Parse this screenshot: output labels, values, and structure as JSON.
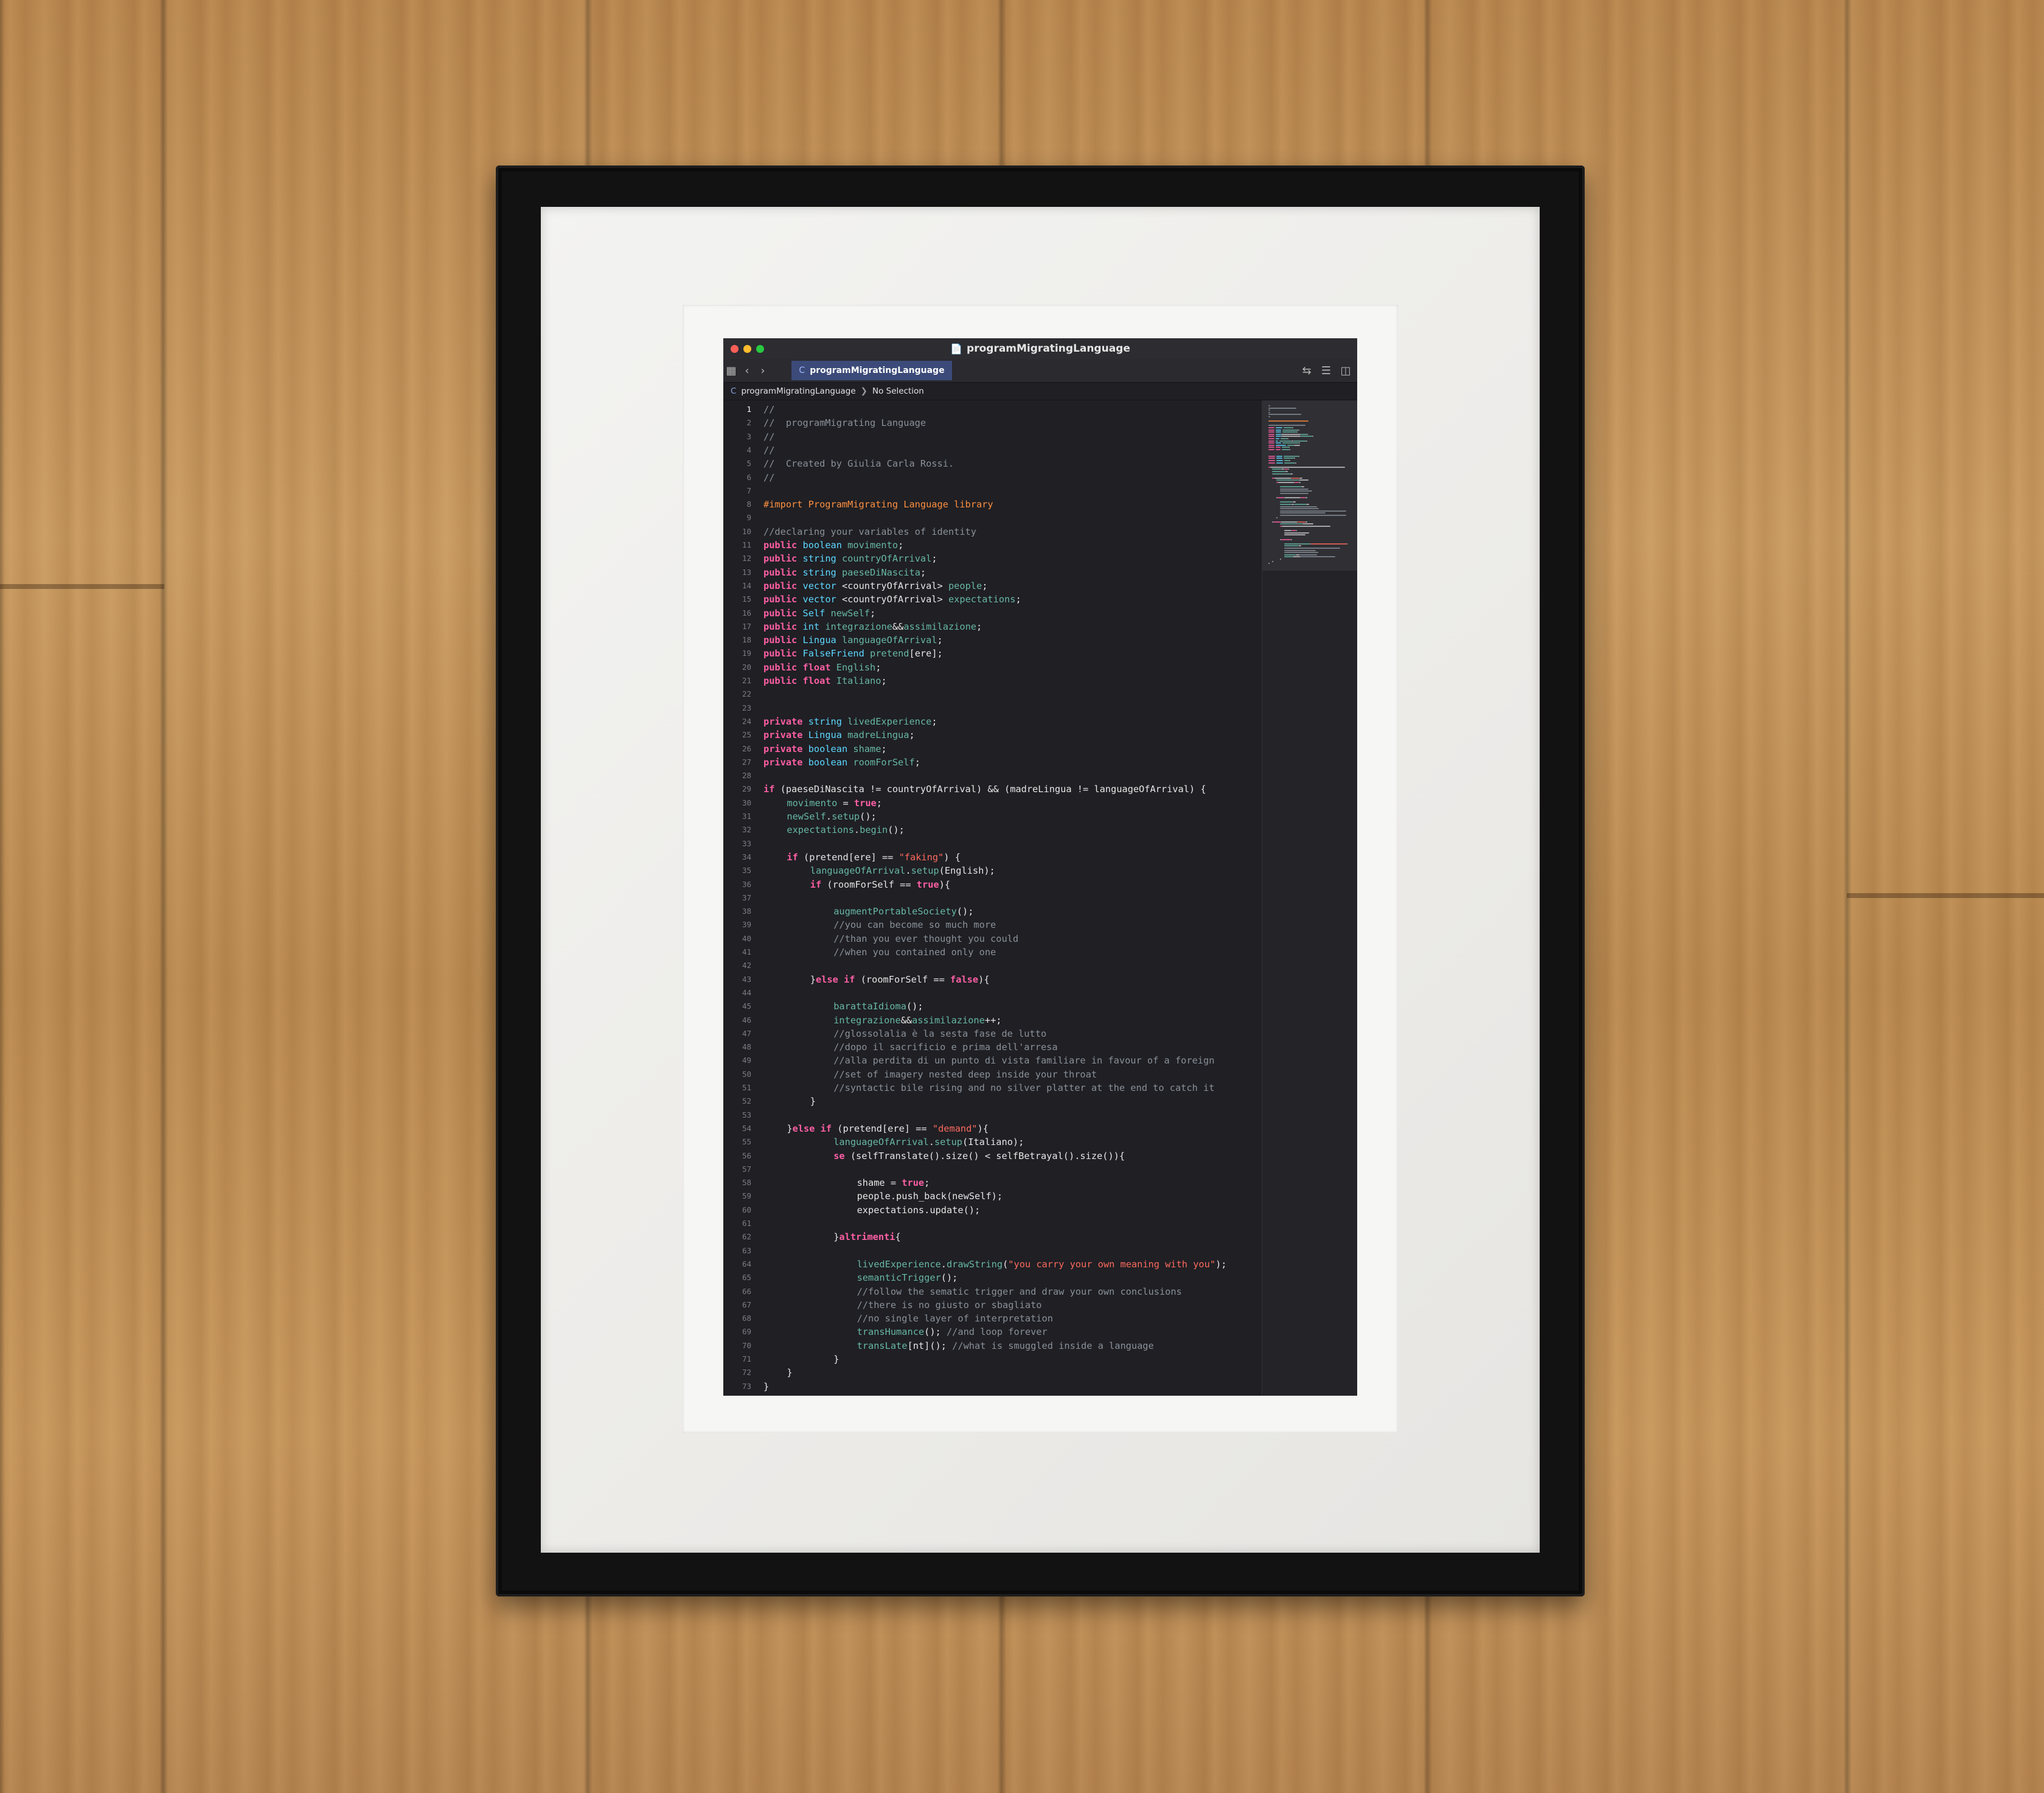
{
  "window": {
    "title": "programMigratingLanguage",
    "tab_label": "programMigratingLanguage",
    "tab_icon": "C",
    "breadcrumb": {
      "file": "programMigratingLanguage",
      "selection": "No Selection"
    },
    "current_line": 1
  },
  "code_lines": [
    {
      "n": "1",
      "indent": 0,
      "tokens": [
        [
          "cm",
          "//"
        ]
      ]
    },
    {
      "n": "2",
      "indent": 0,
      "tokens": [
        [
          "cm",
          "//  programMigrating Language"
        ]
      ]
    },
    {
      "n": "3",
      "indent": 0,
      "tokens": [
        [
          "cm",
          "//"
        ]
      ]
    },
    {
      "n": "4",
      "indent": 0,
      "tokens": [
        [
          "cm",
          "//"
        ]
      ]
    },
    {
      "n": "5",
      "indent": 0,
      "tokens": [
        [
          "cm",
          "//  Created by Giulia Carla Rossi."
        ]
      ]
    },
    {
      "n": "6",
      "indent": 0,
      "tokens": [
        [
          "cm",
          "//"
        ]
      ]
    },
    {
      "n": "7",
      "indent": 0,
      "tokens": []
    },
    {
      "n": "8",
      "indent": 0,
      "tokens": [
        [
          "pp",
          "#import ProgramMigrating Language library"
        ]
      ]
    },
    {
      "n": "9",
      "indent": 0,
      "tokens": []
    },
    {
      "n": "10",
      "indent": 0,
      "tokens": [
        [
          "cm",
          "//declaring your variables of identity"
        ]
      ]
    },
    {
      "n": "11",
      "indent": 0,
      "tokens": [
        [
          "kw",
          "public"
        ],
        [
          "pl",
          " "
        ],
        [
          "ty",
          "boolean"
        ],
        [
          "pl",
          " "
        ],
        [
          "id",
          "movimento"
        ],
        [
          "pl",
          ";"
        ]
      ]
    },
    {
      "n": "12",
      "indent": 0,
      "tokens": [
        [
          "kw",
          "public"
        ],
        [
          "pl",
          " "
        ],
        [
          "ty",
          "string"
        ],
        [
          "pl",
          " "
        ],
        [
          "id",
          "countryOfArrival"
        ],
        [
          "pl",
          ";"
        ]
      ]
    },
    {
      "n": "13",
      "indent": 0,
      "tokens": [
        [
          "kw",
          "public"
        ],
        [
          "pl",
          " "
        ],
        [
          "ty",
          "string"
        ],
        [
          "pl",
          " "
        ],
        [
          "id",
          "paeseDiNascita"
        ],
        [
          "pl",
          ";"
        ]
      ]
    },
    {
      "n": "14",
      "indent": 0,
      "tokens": [
        [
          "kw",
          "public"
        ],
        [
          "pl",
          " "
        ],
        [
          "ty",
          "vector"
        ],
        [
          "pl",
          " <countryOfArrival> "
        ],
        [
          "id",
          "people"
        ],
        [
          "pl",
          ";"
        ]
      ]
    },
    {
      "n": "15",
      "indent": 0,
      "tokens": [
        [
          "kw",
          "public"
        ],
        [
          "pl",
          " "
        ],
        [
          "ty",
          "vector"
        ],
        [
          "pl",
          " <countryOfArrival> "
        ],
        [
          "id",
          "expectations"
        ],
        [
          "pl",
          ";"
        ]
      ]
    },
    {
      "n": "16",
      "indent": 0,
      "tokens": [
        [
          "kw",
          "public"
        ],
        [
          "pl",
          " "
        ],
        [
          "ty",
          "Self"
        ],
        [
          "pl",
          " "
        ],
        [
          "id",
          "newSelf"
        ],
        [
          "pl",
          ";"
        ]
      ]
    },
    {
      "n": "17",
      "indent": 0,
      "tokens": [
        [
          "kw",
          "public"
        ],
        [
          "pl",
          " "
        ],
        [
          "ty",
          "int"
        ],
        [
          "pl",
          " "
        ],
        [
          "id",
          "integrazione"
        ],
        [
          "pl",
          "&&"
        ],
        [
          "id",
          "assimilazione"
        ],
        [
          "pl",
          ";"
        ]
      ]
    },
    {
      "n": "18",
      "indent": 0,
      "tokens": [
        [
          "kw",
          "public"
        ],
        [
          "pl",
          " "
        ],
        [
          "ty",
          "Lingua"
        ],
        [
          "pl",
          " "
        ],
        [
          "id",
          "languageOfArrival"
        ],
        [
          "pl",
          ";"
        ]
      ]
    },
    {
      "n": "19",
      "indent": 0,
      "tokens": [
        [
          "kw",
          "public"
        ],
        [
          "pl",
          " "
        ],
        [
          "ty",
          "FalseFriend"
        ],
        [
          "pl",
          " "
        ],
        [
          "id",
          "pretend"
        ],
        [
          "pl",
          "[ere];"
        ]
      ]
    },
    {
      "n": "20",
      "indent": 0,
      "tokens": [
        [
          "kw",
          "public"
        ],
        [
          "pl",
          " "
        ],
        [
          "kw",
          "float"
        ],
        [
          "pl",
          " "
        ],
        [
          "id",
          "English"
        ],
        [
          "pl",
          ";"
        ]
      ]
    },
    {
      "n": "21",
      "indent": 0,
      "tokens": [
        [
          "kw",
          "public"
        ],
        [
          "pl",
          " "
        ],
        [
          "kw",
          "float"
        ],
        [
          "pl",
          " "
        ],
        [
          "id",
          "Italiano"
        ],
        [
          "pl",
          ";"
        ]
      ]
    },
    {
      "n": "22",
      "indent": 0,
      "tokens": []
    },
    {
      "n": "23",
      "indent": 0,
      "tokens": []
    },
    {
      "n": "24",
      "indent": 0,
      "tokens": [
        [
          "kw",
          "private"
        ],
        [
          "pl",
          " "
        ],
        [
          "ty",
          "string"
        ],
        [
          "pl",
          " "
        ],
        [
          "id",
          "livedExperience"
        ],
        [
          "pl",
          ";"
        ]
      ]
    },
    {
      "n": "25",
      "indent": 0,
      "tokens": [
        [
          "kw",
          "private"
        ],
        [
          "pl",
          " "
        ],
        [
          "ty",
          "Lingua"
        ],
        [
          "pl",
          " "
        ],
        [
          "id",
          "madreLingua"
        ],
        [
          "pl",
          ";"
        ]
      ]
    },
    {
      "n": "26",
      "indent": 0,
      "tokens": [
        [
          "kw",
          "private"
        ],
        [
          "pl",
          " "
        ],
        [
          "ty",
          "boolean"
        ],
        [
          "pl",
          " "
        ],
        [
          "id",
          "shame"
        ],
        [
          "pl",
          ";"
        ]
      ]
    },
    {
      "n": "27",
      "indent": 0,
      "tokens": [
        [
          "kw",
          "private"
        ],
        [
          "pl",
          " "
        ],
        [
          "ty",
          "boolean"
        ],
        [
          "pl",
          " "
        ],
        [
          "id",
          "roomForSelf"
        ],
        [
          "pl",
          ";"
        ]
      ]
    },
    {
      "n": "28",
      "indent": 0,
      "tokens": []
    },
    {
      "n": "29",
      "indent": 0,
      "tokens": [
        [
          "kw",
          "if"
        ],
        [
          "pl",
          " (paeseDiNascita != countryOfArrival) && (madreLingua != languageOfArrival) {"
        ]
      ]
    },
    {
      "n": "30",
      "indent": 4,
      "tokens": [
        [
          "id",
          "movimento"
        ],
        [
          "pl",
          " = "
        ],
        [
          "kw",
          "true"
        ],
        [
          "pl",
          ";"
        ]
      ]
    },
    {
      "n": "31",
      "indent": 4,
      "tokens": [
        [
          "id",
          "newSelf"
        ],
        [
          "pl",
          "."
        ],
        [
          "fn",
          "setup"
        ],
        [
          "pl",
          "();"
        ]
      ]
    },
    {
      "n": "32",
      "indent": 4,
      "tokens": [
        [
          "id",
          "expectations"
        ],
        [
          "pl",
          "."
        ],
        [
          "fn",
          "begin"
        ],
        [
          "pl",
          "();"
        ]
      ]
    },
    {
      "n": "33",
      "indent": 0,
      "tokens": []
    },
    {
      "n": "34",
      "indent": 4,
      "tokens": [
        [
          "kw",
          "if"
        ],
        [
          "pl",
          " (pretend[ere] == "
        ],
        [
          "st",
          "\"faking\""
        ],
        [
          "pl",
          ") {"
        ]
      ]
    },
    {
      "n": "35",
      "indent": 8,
      "tokens": [
        [
          "id",
          "languageOfArrival"
        ],
        [
          "pl",
          "."
        ],
        [
          "fn",
          "setup"
        ],
        [
          "pl",
          "(English);"
        ]
      ]
    },
    {
      "n": "36",
      "indent": 8,
      "tokens": [
        [
          "kw",
          "if"
        ],
        [
          "pl",
          " (roomForSelf == "
        ],
        [
          "kw",
          "true"
        ],
        [
          "pl",
          "){"
        ]
      ]
    },
    {
      "n": "37",
      "indent": 0,
      "tokens": []
    },
    {
      "n": "38",
      "indent": 12,
      "tokens": [
        [
          "fn",
          "augmentPortableSociety"
        ],
        [
          "pl",
          "();"
        ]
      ]
    },
    {
      "n": "39",
      "indent": 12,
      "tokens": [
        [
          "cm",
          "//you can become so much more"
        ]
      ]
    },
    {
      "n": "40",
      "indent": 12,
      "tokens": [
        [
          "cm",
          "//than you ever thought you could"
        ]
      ]
    },
    {
      "n": "41",
      "indent": 12,
      "tokens": [
        [
          "cm",
          "//when you contained only one"
        ]
      ]
    },
    {
      "n": "42",
      "indent": 0,
      "tokens": []
    },
    {
      "n": "43",
      "indent": 8,
      "tokens": [
        [
          "pl",
          "}"
        ],
        [
          "kw",
          "else if"
        ],
        [
          "pl",
          " (roomForSelf == "
        ],
        [
          "kw",
          "false"
        ],
        [
          "pl",
          "){"
        ]
      ]
    },
    {
      "n": "44",
      "indent": 0,
      "tokens": []
    },
    {
      "n": "45",
      "indent": 12,
      "tokens": [
        [
          "fn",
          "barattaIdioma"
        ],
        [
          "pl",
          "();"
        ]
      ]
    },
    {
      "n": "46",
      "indent": 12,
      "tokens": [
        [
          "id",
          "integrazione"
        ],
        [
          "pl",
          "&&"
        ],
        [
          "id",
          "assimilazione"
        ],
        [
          "pl",
          "++;"
        ]
      ]
    },
    {
      "n": "47",
      "indent": 12,
      "tokens": [
        [
          "cm",
          "//glossolalia è la sesta fase de lutto"
        ]
      ]
    },
    {
      "n": "48",
      "indent": 12,
      "tokens": [
        [
          "cm",
          "//dopo il sacrificio e prima dell'arresa"
        ]
      ]
    },
    {
      "n": "49",
      "indent": 12,
      "tokens": [
        [
          "cm",
          "//alla perdita di un punto di vista familiare in favour of a foreign"
        ]
      ]
    },
    {
      "n": "50",
      "indent": 12,
      "tokens": [
        [
          "cm",
          "//set of imagery nested deep inside your throat"
        ]
      ]
    },
    {
      "n": "51",
      "indent": 12,
      "tokens": [
        [
          "cm",
          "//syntactic bile rising and no silver platter at the end to catch it"
        ]
      ]
    },
    {
      "n": "52",
      "indent": 8,
      "tokens": [
        [
          "pl",
          "}"
        ]
      ]
    },
    {
      "n": "53",
      "indent": 0,
      "tokens": []
    },
    {
      "n": "54",
      "indent": 4,
      "tokens": [
        [
          "pl",
          "}"
        ],
        [
          "kw",
          "else if"
        ],
        [
          "pl",
          " (pretend[ere] == "
        ],
        [
          "st",
          "\"demand\""
        ],
        [
          "pl",
          "){"
        ]
      ]
    },
    {
      "n": "55",
      "indent": 12,
      "tokens": [
        [
          "id",
          "languageOfArrival"
        ],
        [
          "pl",
          "."
        ],
        [
          "fn",
          "setup"
        ],
        [
          "pl",
          "(Italiano);"
        ]
      ]
    },
    {
      "n": "56",
      "indent": 12,
      "tokens": [
        [
          "kw",
          "se"
        ],
        [
          "pl",
          " (selfTranslate().size() < selfBetrayal().size()){"
        ]
      ]
    },
    {
      "n": "57",
      "indent": 0,
      "tokens": []
    },
    {
      "n": "58",
      "indent": 16,
      "tokens": [
        [
          "pl",
          "shame = "
        ],
        [
          "kw",
          "true"
        ],
        [
          "pl",
          ";"
        ]
      ]
    },
    {
      "n": "59",
      "indent": 16,
      "tokens": [
        [
          "pl",
          "people.push_back(newSelf);"
        ]
      ]
    },
    {
      "n": "60",
      "indent": 16,
      "tokens": [
        [
          "pl",
          "expectations.update();"
        ]
      ]
    },
    {
      "n": "61",
      "indent": 0,
      "tokens": []
    },
    {
      "n": "62",
      "indent": 12,
      "tokens": [
        [
          "pl",
          "}"
        ],
        [
          "kw",
          "altrimenti"
        ],
        [
          "pl",
          "{"
        ]
      ]
    },
    {
      "n": "63",
      "indent": 0,
      "tokens": []
    },
    {
      "n": "64",
      "indent": 16,
      "tokens": [
        [
          "id",
          "livedExperience"
        ],
        [
          "pl",
          "."
        ],
        [
          "fn",
          "drawString"
        ],
        [
          "pl",
          "("
        ],
        [
          "st",
          "\"you carry your own meaning with you\""
        ],
        [
          "pl",
          ");"
        ]
      ]
    },
    {
      "n": "65",
      "indent": 16,
      "tokens": [
        [
          "fn",
          "semanticTrigger"
        ],
        [
          "pl",
          "();"
        ]
      ]
    },
    {
      "n": "66",
      "indent": 16,
      "tokens": [
        [
          "cm",
          "//follow the sematic trigger and draw your own conclusions"
        ]
      ]
    },
    {
      "n": "67",
      "indent": 16,
      "tokens": [
        [
          "cm",
          "//there is no giusto or sbagliato"
        ]
      ]
    },
    {
      "n": "68",
      "indent": 16,
      "tokens": [
        [
          "cm",
          "//no single layer of interpretation"
        ]
      ]
    },
    {
      "n": "69",
      "indent": 16,
      "tokens": [
        [
          "fn",
          "transHumance"
        ],
        [
          "pl",
          "(); "
        ],
        [
          "cm",
          "//and loop forever"
        ]
      ]
    },
    {
      "n": "70",
      "indent": 16,
      "tokens": [
        [
          "fn",
          "transLate"
        ],
        [
          "pl",
          "[nt](); "
        ],
        [
          "cm",
          "//what is smuggled inside a language"
        ]
      ]
    },
    {
      "n": "71",
      "indent": 12,
      "tokens": [
        [
          "pl",
          "}"
        ]
      ]
    },
    {
      "n": "72",
      "indent": 4,
      "tokens": [
        [
          "pl",
          "}"
        ]
      ]
    },
    {
      "n": "73",
      "indent": 0,
      "tokens": [
        [
          "pl",
          "}"
        ]
      ]
    }
  ],
  "icons": {
    "doc": "document-icon",
    "grid": "grid-icon",
    "back": "chevron-left-icon",
    "forward": "chevron-right-icon",
    "swap": "swap-icon",
    "editor_options": "editor-options-icon",
    "inspector": "inspector-toggle-icon"
  },
  "colors": {
    "keyword": "#fc5fa3",
    "type": "#5dd8ff",
    "identifier": "#67b7a4",
    "comment": "#8a9199",
    "string": "#fc6a5d",
    "preprocessor": "#fd8f3f",
    "editor_background": "#1f1f24",
    "tab_active": "#3b4a78"
  }
}
